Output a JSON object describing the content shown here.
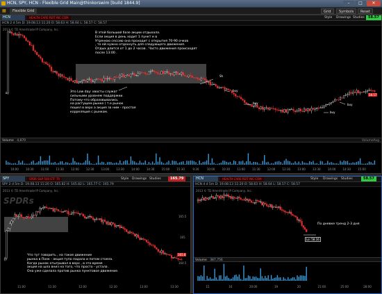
{
  "window": {
    "title": "HCN, SPY, HCN - Flexible Grid Main@thinkorswim [build 1844.9]",
    "min_glyph": "–",
    "max_glyph": "□",
    "close_glyph": "✕"
  },
  "menubar": {
    "tab": "Flexible Grid",
    "buttons": [
      "Grid",
      "Symbols",
      "Reset"
    ]
  },
  "top_pane": {
    "symbol": "HCN",
    "description": "HEALTH CARE REIT INC COM",
    "buttons": [
      "Style",
      "Drawings",
      "Studies"
    ],
    "price": "58.57",
    "quote": "HCN 2 d 5m  D: 19.08.13 11:20  O: 58.63  H: 58.64  L: 58.57  C: 58.57",
    "copyright": "2013 © TD Ameritrade IP Company, Inc.",
    "price_flag": "58.57",
    "top_note": "В этой  большой базе акции отдыхала.\nЕсли акция в день ходит 1 пункт и в\nУтренюю сессию она проходит с открытия 70-90 очков\n, то ей нужно отдохнуть для следующего движения.\nОтдых длится от 1 до 2 часов . Часто движения происходят\nпосле 13:00 .",
    "left_note": "Это Low day: хвосты служат\nсильными уровнем поддержки.\nПотому-что образовывались\nна растущем рынке ( т.е рынок\nпошел в верх а акция за ним - простая\nкорреляция с рынком.",
    "sh_label": "Sh",
    "buy_labels": [
      "buy",
      "buy",
      "buy",
      "buy"
    ],
    "volume_label": "Volume",
    "volume_value": "4,870",
    "volume_tag": "VolumeAvg",
    "x_ticks": [
      "10:00",
      "10:30",
      "11:00",
      "11:30",
      "12:00",
      "12:30",
      "13:00",
      "13:30",
      "14:00",
      "14:30",
      "15:00",
      "15:30",
      "9:30",
      "10:00",
      "10:30",
      "11:00",
      "11:30",
      "12:00",
      "12:30",
      "13:00",
      "13:30",
      "14:00",
      "14:30",
      "15:00"
    ]
  },
  "spy_pane": {
    "symbol": "SPY",
    "description": "SPDR S&P 500 ETF TR",
    "buttons": [
      "Style",
      "Drawings",
      "Studies"
    ],
    "price": "165.79",
    "quote": "SPY 2 d 5m  D: 19.08.13 11:20  O: 165.82  H: 165.82  L: 165.77  C: 165.79",
    "copyright": "2013 © TD Ameritrade IP Company, Inc.",
    "logo": "SPDRs",
    "price_flag": "165.8",
    "y_ticks": [
      "165.5",
      "165",
      "164.5"
    ],
    "note": "Что тут говорить , на такое движение\nрынка в Понк - акция тупо падала и потом  стояла.\nКогда рынок отыгрывал в верх , в это время\nакция на шла вниз на того, что просто - устала .\nОна уже сделала против рынка пунктовое движение.",
    "x_ticks": [
      "11:00",
      "11:30",
      "12:00",
      "12:30",
      "13:00",
      "13:30"
    ]
  },
  "hcn_small_pane": {
    "symbol": "HCN",
    "description": "HEALTH CARE REIT INC COM",
    "buttons": [
      "Style",
      "Drawings",
      "Studies"
    ],
    "price": "58.57",
    "quote": "HCN 4 d 5m  D: 19.08.13 11:20  O: 58.63  H: 58.64  L: 58.57  C: 58.57",
    "copyright": "2013 © TD Ameritrade IP Company, Inc.",
    "note": "По дневке тренд 2-3 дня",
    "lo_label": "Lo: 58.16",
    "volume_label": "Volume",
    "volume_value": "387,756",
    "x_ticks": [
      "15",
      "16",
      "20:00",
      "19",
      "20",
      "21:00",
      "25:00",
      "28:00"
    ]
  },
  "colors": {
    "accent_red": "#e02020",
    "accent_green": "#2ecc40",
    "candle_up": "#dcdcdc",
    "candle_down": "#e03030"
  }
}
